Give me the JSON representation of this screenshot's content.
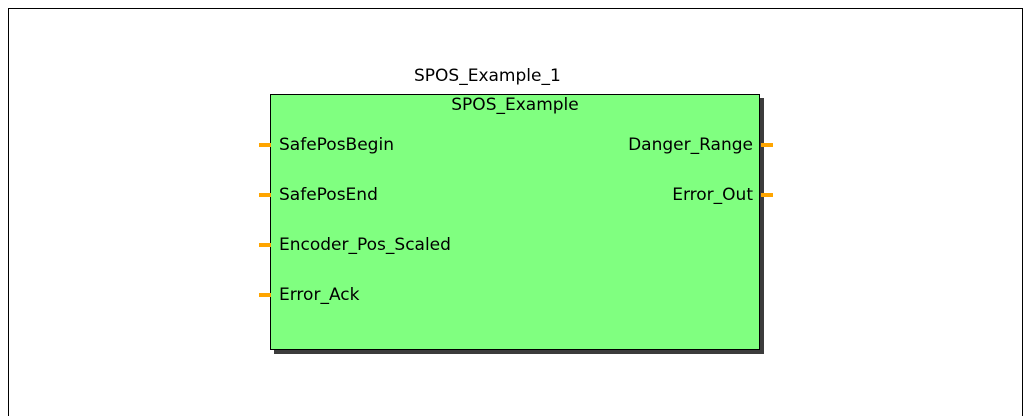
{
  "diagram": {
    "instance_name": "SPOS_Example_1",
    "block_type": "SPOS_Example",
    "pin_color": "#ffa500",
    "block_color": "#80ff80",
    "inputs": [
      {
        "label": "SafePosBegin"
      },
      {
        "label": "SafePosEnd"
      },
      {
        "label": "Encoder_Pos_Scaled"
      },
      {
        "label": "Error_Ack"
      }
    ],
    "outputs": [
      {
        "label": "Danger_Range"
      },
      {
        "label": "Error_Out"
      }
    ]
  }
}
